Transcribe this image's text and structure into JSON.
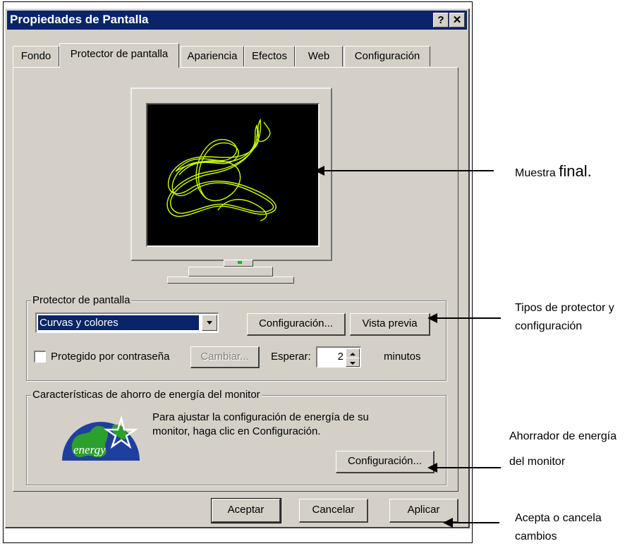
{
  "window": {
    "title": "Propiedades de Pantalla",
    "help_label": "?",
    "close_label": "✕"
  },
  "tabs": [
    {
      "label": "Fondo"
    },
    {
      "label": "Protector de pantalla"
    },
    {
      "label": "Apariencia"
    },
    {
      "label": "Efectos"
    },
    {
      "label": "Web"
    },
    {
      "label": "Configuración"
    }
  ],
  "screensaver_group": {
    "label": "Protector de pantalla",
    "selected": "Curvas y colores",
    "config_button": "Configuración...",
    "preview_button": "Vista previa",
    "password_label": "Protegido por contraseña",
    "change_button": "Cambiar...",
    "wait_label": "Esperar:",
    "wait_value": "2",
    "minutes_label": "minutos"
  },
  "energy_group": {
    "label": "Características de ahorro de energía del monitor",
    "description_line1": "Para ajustar la configuración de energía de su",
    "description_line2": "monitor, haga clic en Configuración.",
    "logo_text": "energy",
    "config_button": "Configuración..."
  },
  "footer": {
    "ok_button": "Aceptar",
    "cancel_button": "Cancelar",
    "apply_button": "Aplicar"
  },
  "annotations": {
    "preview_small": "Muestra ",
    "preview_large": "final.",
    "types_line1": "Tipos de protector y",
    "types_line2": "configuración",
    "energy_line1": "Ahorrador de energía",
    "energy_line2": "del monitor",
    "accept_line1": "Acepta o cancela",
    "accept_line2": "cambios"
  },
  "colors": {
    "titlebar": "#0a246a",
    "dialog_face": "#d4d0c8",
    "curve": "#c8ff00"
  }
}
